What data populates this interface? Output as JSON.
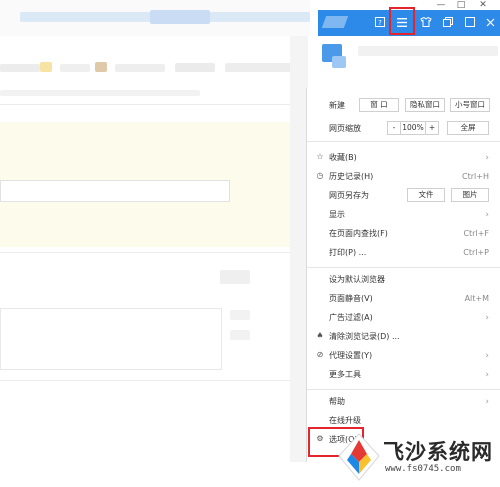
{
  "title_bar": {
    "icons": [
      "browser-tab-icon",
      "help-icon",
      "menu-icon",
      "skin-icon",
      "restore-icon"
    ],
    "window_controls": [
      "—",
      "□",
      "✕"
    ]
  },
  "menu": {
    "new_label": "新建",
    "new_window": "窗 口",
    "private_window": "隐私窗口",
    "small_window": "小号窗口",
    "zoom_label": "网页缩放",
    "zoom_minus": "-",
    "zoom_value": "100%",
    "zoom_plus": "+",
    "fullscreen": "全屏",
    "favorites": "收藏(B)",
    "history": "历史记录(H)",
    "history_shortcut": "Ctrl+H",
    "save_as": "网页另存为",
    "save_file": "文件",
    "save_image": "图片",
    "display": "显示",
    "find": "在页面内查找(F)",
    "find_shortcut": "Ctrl+F",
    "print": "打印(P) ...",
    "print_shortcut": "Ctrl+P",
    "set_default": "设为默认浏览器",
    "mute": "页面静音(V)",
    "mute_shortcut": "Alt+M",
    "ad_filter": "广告过滤(A)",
    "clear_data": "清除浏览记录(D) ...",
    "proxy": "代理设置(Y)",
    "more_tools": "更多工具",
    "help": "帮助",
    "update": "在线升级",
    "options": "选项(O)"
  },
  "watermark": {
    "brand": "飞沙系统网",
    "url": "www.fs0745.com"
  },
  "colors": {
    "title_blue": "#2d8ae9",
    "highlight_red": "#e4262c"
  }
}
